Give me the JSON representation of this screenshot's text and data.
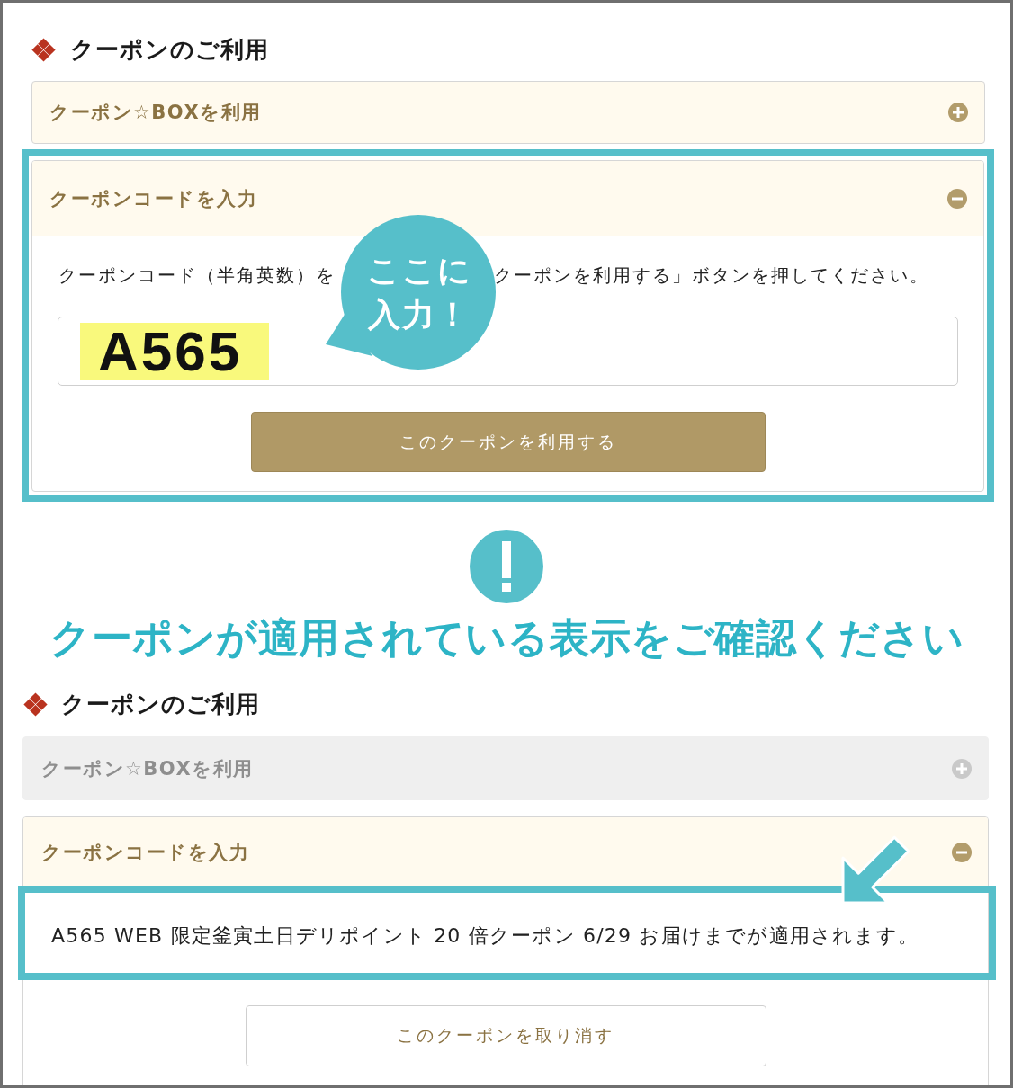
{
  "upper_panel": {
    "heading": "クーポンのご利用",
    "accordions": [
      {
        "label": "クーポン☆BOXを利用",
        "expanded": false,
        "disabled": false,
        "highlighted": false
      },
      {
        "label": "クーポンコードを入力",
        "expanded": true,
        "disabled": false,
        "highlighted": true,
        "body": {
          "kind": "entry",
          "instruction_before": "クーポンコード（半角英数）を",
          "instruction_after": "クーポンを利用する」ボタンを押してください。",
          "field": {
            "value": "A565",
            "marked": true
          },
          "callout": {
            "lines": [
              "ここに",
              "入力！"
            ]
          },
          "button": {
            "label": "このクーポンを利用する",
            "kind": "primary"
          }
        }
      }
    ]
  },
  "notice": {
    "text": "クーポンが適用されている表示をご確認ください"
  },
  "lower_panel": {
    "heading": "クーポンのご利用",
    "accordions": [
      {
        "label": "クーポン☆BOXを利用",
        "expanded": false,
        "disabled": true,
        "highlighted": false
      },
      {
        "label": "クーポンコードを入力",
        "expanded": true,
        "disabled": false,
        "highlighted": false,
        "body": {
          "kind": "applied",
          "message": "A565 WEB 限定釜寅土日デリポイント 20 倍クーポン 6/29 お届けまでが適用されます。",
          "message_highlighted": true,
          "button": {
            "label": "このクーポンを取り消す",
            "kind": "secondary"
          }
        }
      }
    ]
  }
}
